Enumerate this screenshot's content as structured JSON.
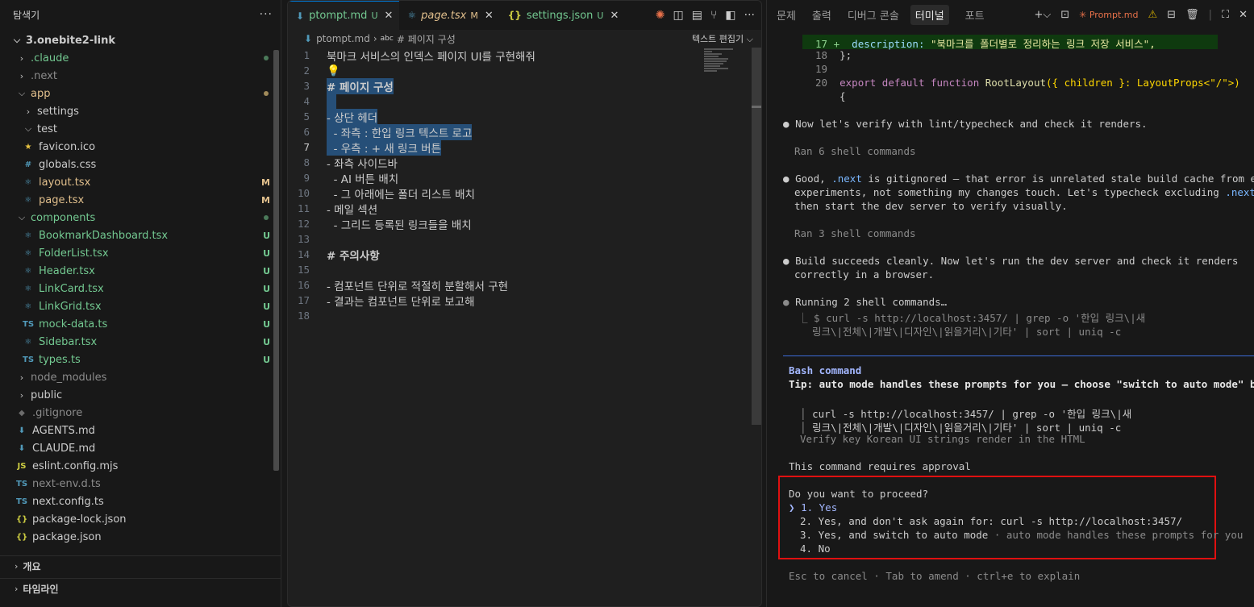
{
  "explorer": {
    "title": "탐색기",
    "more": "···",
    "root": "3.onebite2-link",
    "items": [
      {
        "label": ".claude",
        "type": "folder",
        "indent": 1,
        "open": false,
        "status": "dot"
      },
      {
        "label": ".next",
        "type": "folder",
        "indent": 1,
        "open": false,
        "status": ""
      },
      {
        "label": "app",
        "type": "folder",
        "indent": 1,
        "open": true,
        "status": "dot-mod"
      },
      {
        "label": "settings",
        "type": "folder",
        "indent": 2,
        "open": false,
        "status": ""
      },
      {
        "label": "test",
        "type": "folder",
        "indent": 2,
        "open": true,
        "status": ""
      },
      {
        "label": "favicon.ico",
        "type": "ico",
        "indent": 2,
        "status": ""
      },
      {
        "label": "globals.css",
        "type": "css",
        "indent": 2,
        "status": ""
      },
      {
        "label": "layout.tsx",
        "type": "tsx",
        "indent": 2,
        "status": "M"
      },
      {
        "label": "page.tsx",
        "type": "tsx",
        "indent": 2,
        "status": "M"
      },
      {
        "label": "components",
        "type": "folder",
        "indent": 1,
        "open": true,
        "status": "dot"
      },
      {
        "label": "BookmarkDashboard.tsx",
        "type": "tsx",
        "indent": 2,
        "status": "U"
      },
      {
        "label": "FolderList.tsx",
        "type": "tsx",
        "indent": 2,
        "status": "U"
      },
      {
        "label": "Header.tsx",
        "type": "tsx",
        "indent": 2,
        "status": "U"
      },
      {
        "label": "LinkCard.tsx",
        "type": "tsx",
        "indent": 2,
        "status": "U"
      },
      {
        "label": "LinkGrid.tsx",
        "type": "tsx",
        "indent": 2,
        "status": "U"
      },
      {
        "label": "mock-data.ts",
        "type": "ts",
        "indent": 2,
        "status": "U"
      },
      {
        "label": "Sidebar.tsx",
        "type": "tsx",
        "indent": 2,
        "status": "U"
      },
      {
        "label": "types.ts",
        "type": "ts",
        "indent": 2,
        "status": "U"
      },
      {
        "label": "node_modules",
        "type": "folder",
        "indent": 1,
        "open": false,
        "status": ""
      },
      {
        "label": "public",
        "type": "folder",
        "indent": 1,
        "open": false,
        "status": ""
      },
      {
        "label": ".gitignore",
        "type": "git",
        "indent": 1,
        "status": ""
      },
      {
        "label": "AGENTS.md",
        "type": "md",
        "indent": 1,
        "status": ""
      },
      {
        "label": "CLAUDE.md",
        "type": "md",
        "indent": 1,
        "status": ""
      },
      {
        "label": "eslint.config.mjs",
        "type": "js",
        "indent": 1,
        "status": ""
      },
      {
        "label": "next-env.d.ts",
        "type": "ts",
        "indent": 1,
        "status": ""
      },
      {
        "label": "next.config.ts",
        "type": "ts",
        "indent": 1,
        "status": ""
      },
      {
        "label": "package-lock.json",
        "type": "json",
        "indent": 1,
        "status": ""
      },
      {
        "label": "package.json",
        "type": "json",
        "indent": 1,
        "status": ""
      }
    ],
    "sections": {
      "outline": "개요",
      "timeline": "타임라인"
    }
  },
  "editor": {
    "tabs": [
      {
        "label": "ptompt.md",
        "status": "U",
        "icon": "markdown",
        "active": true
      },
      {
        "label": "page.tsx",
        "status": "M",
        "icon": "react",
        "active": false
      },
      {
        "label": "settings.json",
        "status": "U",
        "icon": "json",
        "active": false
      }
    ],
    "breadcrumb": {
      "file": "ptompt.md",
      "symbol": "# 페이지 구성",
      "right": "텍스트 편집기"
    },
    "lines": [
      {
        "n": "1",
        "text": "북마크 서비스의 인덱스 페이지 UI를 구현해줘",
        "kind": "plain"
      },
      {
        "n": "2",
        "text": "💡",
        "kind": "bulb"
      },
      {
        "n": "3",
        "text": "# 페이지 구성",
        "kind": "h1"
      },
      {
        "n": "4",
        "text": "",
        "kind": "blank-sel"
      },
      {
        "n": "5",
        "text": "- 상단 헤더",
        "kind": "list-sel"
      },
      {
        "n": "6",
        "text": "  - 좌측 : 한입 링크 텍스트 로고",
        "kind": "sublist-sel"
      },
      {
        "n": "7",
        "text": "  - 우측 : + 새 링크 버튼",
        "kind": "sublist-sel"
      },
      {
        "n": "8",
        "text": "- 좌측 사이드바",
        "kind": "list"
      },
      {
        "n": "9",
        "text": "  - AI 버튼 배치",
        "kind": "sublist"
      },
      {
        "n": "10",
        "text": "  - 그 아래에는 폴더 리스트 배치",
        "kind": "sublist"
      },
      {
        "n": "11",
        "text": "- 메일 섹션",
        "kind": "list"
      },
      {
        "n": "12",
        "text": "  - 그리드 등록된 링크들을 배치",
        "kind": "sublist"
      },
      {
        "n": "13",
        "text": "",
        "kind": "plain"
      },
      {
        "n": "14",
        "text": "# 주의사항",
        "kind": "h1plain"
      },
      {
        "n": "15",
        "text": "",
        "kind": "plain"
      },
      {
        "n": "16",
        "text": "- 컴포넌트 단위로 적절히 분할해서 구현",
        "kind": "list"
      },
      {
        "n": "17",
        "text": "- 결과는 컴포넌트 단위로 보고해",
        "kind": "list"
      },
      {
        "n": "18",
        "text": "",
        "kind": "plain"
      }
    ]
  },
  "panel": {
    "tabs": [
      "문제",
      "출력",
      "디버그 콘솔",
      "터미널",
      "포트"
    ],
    "active_tab": "터미널",
    "terminal_name": "✳ Prompt.md",
    "terminal": {
      "diff17_num": "17 +",
      "diff17_key": "description:",
      "diff17_val": "\"북마크를 폴더별로 정리하는 링크 저장 서비스\",",
      "l18_num": "18",
      "l18_text": "};",
      "l19_num": "19",
      "l20_num": "20",
      "l20_export": "export default function",
      "l20_fn": "RootLayout",
      "l20_args": "({ children }: LayoutProps<\"/\">)",
      "l20_brace": "{",
      "msg1": "Now let's verify with lint/typecheck and check it renders.",
      "ran1": "Ran 6 shell commands",
      "msg2a": "Good,",
      "msg2_next": ".next",
      "msg2b": "is gitignored — that error is unrelated stale build cache from earlier",
      "msg2c": "experiments, not something my changes touch. Let's typecheck excluding",
      "msg2d": ".next,",
      "msg2e": "then start the dev server to verify visually.",
      "ran2": "Ran 3 shell commands",
      "msg3a": "Build succeeds cleanly. Now let's run the dev server and check it renders",
      "msg3b": "correctly in a browser.",
      "running": "Running 2 shell commands…",
      "cmd1a": "⎿ $ curl -s http://localhost:3457/ | grep -o '한입 링크\\|새",
      "cmd1b": "링크\\|전체\\|개발\\|디자인\\|읽을거리\\|기타' | sort | uniq -c",
      "bash_title": "Bash command",
      "tip": "Tip: auto mode handles these prompts for you — choose \"switch to auto mode\" below",
      "cmd2a": "curl -s http://localhost:3457/ | grep -o '한입 링크\\|새",
      "cmd2b": "링크\\|전체\\|개발\\|디자인\\|읽을거리\\|기타' | sort | uniq -c",
      "verify": "Verify key Korean UI strings render in the HTML",
      "approval": "This command requires approval",
      "proceed": "Do you want to proceed?",
      "opt1": "1. Yes",
      "opt2": "2. Yes, and don't ask again for: curl -s http://localhost:3457/",
      "opt3a": "3. Yes, and switch to auto mode",
      "opt3b": "· auto mode handles these prompts for you",
      "opt4": "4. No",
      "footer": "Esc to cancel · Tab to amend · ctrl+e to explain"
    }
  }
}
